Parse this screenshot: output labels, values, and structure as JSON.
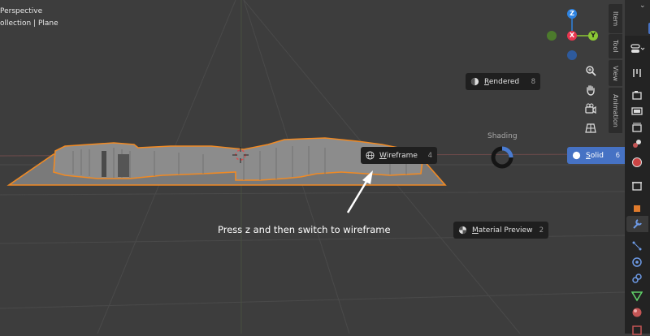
{
  "viewport": {
    "view_name": "Perspective",
    "collection_path": "ollection | Plane"
  },
  "sidebar_tabs": [
    "Item",
    "Tool",
    "View",
    "Animation"
  ],
  "pie_menu": {
    "center_label": "Shading",
    "items": [
      {
        "label_key": "R",
        "label_rest": "endered",
        "shortcut": "8",
        "icon": "rendered-sphere-icon"
      },
      {
        "label_key": "W",
        "label_rest": "ireframe",
        "shortcut": "4",
        "icon": "wireframe-sphere-icon"
      },
      {
        "label_key": "S",
        "label_rest": "olid",
        "shortcut": "6",
        "icon": "solid-sphere-icon",
        "active": true
      },
      {
        "label_key": "M",
        "label_rest": "aterial Preview",
        "shortcut": "2",
        "icon": "material-sphere-icon"
      }
    ]
  },
  "gizmo": {
    "axes": [
      "Z",
      "X",
      "Y"
    ],
    "colors": {
      "x": "#e8364f",
      "y": "#8bc734",
      "z": "#2f83e0"
    }
  },
  "annotation": {
    "text": "Press z and then switch to wireframe"
  },
  "colors": {
    "selection_outline": "#f08a24",
    "accent": "#4672c4"
  }
}
